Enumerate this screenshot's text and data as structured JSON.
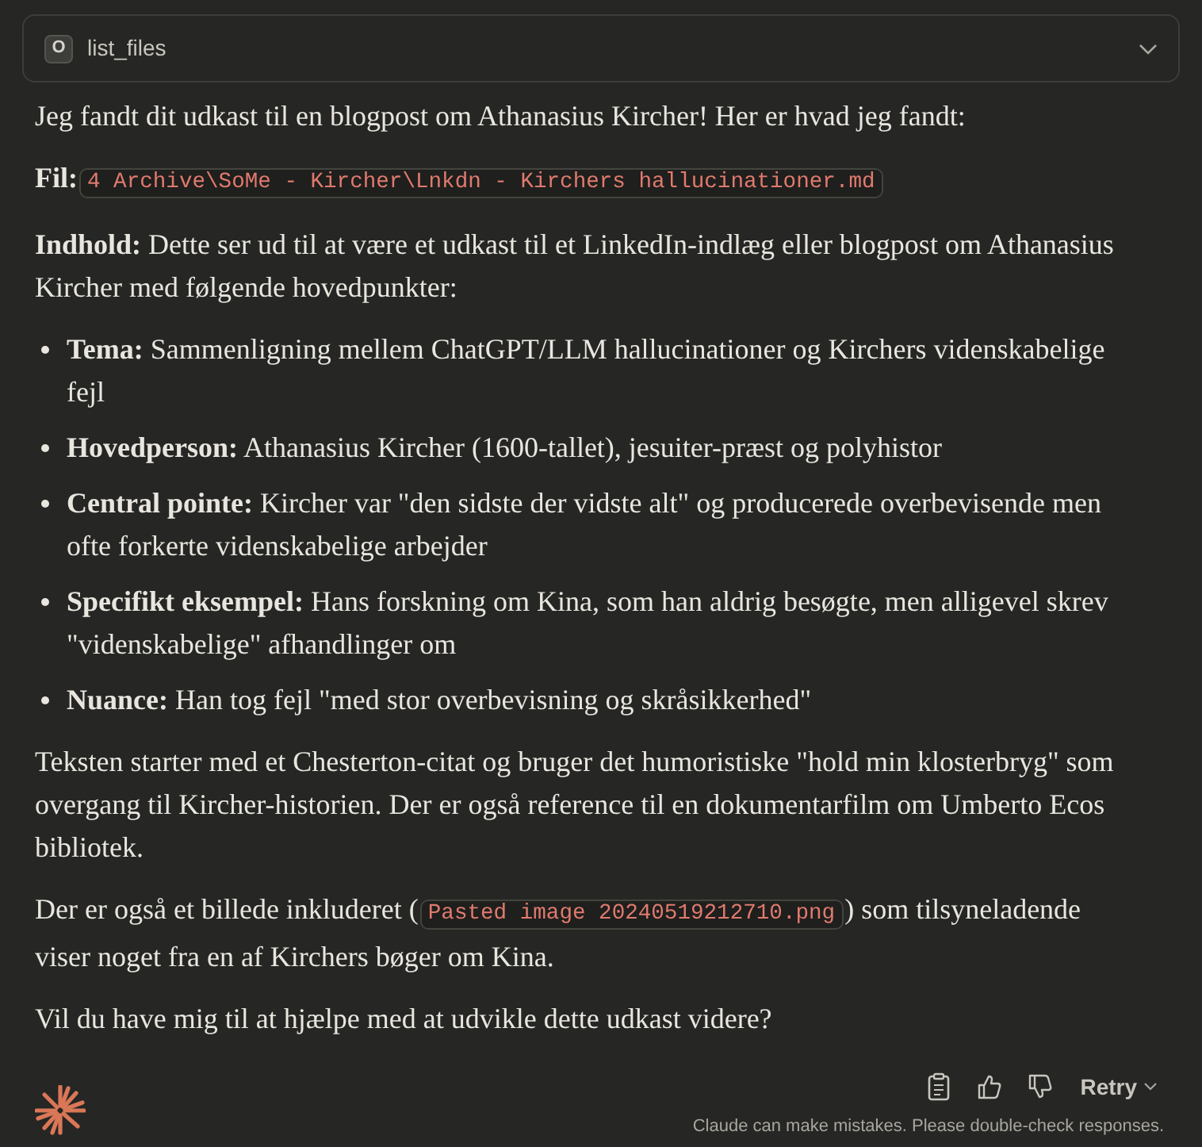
{
  "tool_call": {
    "icon_letter": "O",
    "name": "list_files",
    "expanded": false
  },
  "message": [
    {
      "kind": "paragraph",
      "text": "Jeg fandt dit udkast til en blogpost om Athanasius Kircher! Her er hvad jeg fandt:"
    },
    {
      "kind": "code_line",
      "before": "**Fil:**",
      "code": "4 Archive\\SoMe - Kircher\\Lnkdn - Kirchers hallucinationer.md"
    },
    {
      "kind": "paragraph",
      "text": "**Indhold:** Dette ser ud til at være et udkast til et LinkedIn-indlæg eller blogpost om Athanasius Kircher med følgende hovedpunkter:"
    },
    {
      "kind": "bullets",
      "items": [
        "**Tema:** Sammenligning mellem ChatGPT/LLM hallucinationer og Kirchers videnskabelige fejl",
        "**Hovedperson:** Athanasius Kircher (1600-tallet), jesuiter-præst og polyhistor",
        "**Central pointe:** Kircher var \"den sidste der vidste alt\" og producerede overbevisende men ofte forkerte videnskabelige arbejder",
        "**Specifikt eksempel:** Hans forskning om Kina, som han aldrig besøgte, men alligevel skrev \"videnskabelige\" afhandlinger om",
        "**Nuance:** Han tog fejl \"med stor overbevisning og skråsikkerhed\""
      ]
    },
    {
      "kind": "paragraph",
      "text": "Teksten starter med et Chesterton-citat og bruger det humoristiske \"hold min klosterbryg\" som overgang til Kircher-historien. Der er også reference til en dokumentarfilm om Umberto Ecos bibliotek."
    },
    {
      "kind": "code_line",
      "before": "Der er også et billede inkluderet (",
      "code": "Pasted image 20240519212710.png",
      "after": ") som tilsyneladende viser noget fra en af Kirchers bøger om Kina."
    },
    {
      "kind": "paragraph",
      "text": "Vil du have mig til at hjælpe med at udvikle dette udkast videre?"
    }
  ],
  "footer": {
    "retry": "Retry",
    "disclaimer": "Claude can make mistakes. Please double-check responses."
  }
}
